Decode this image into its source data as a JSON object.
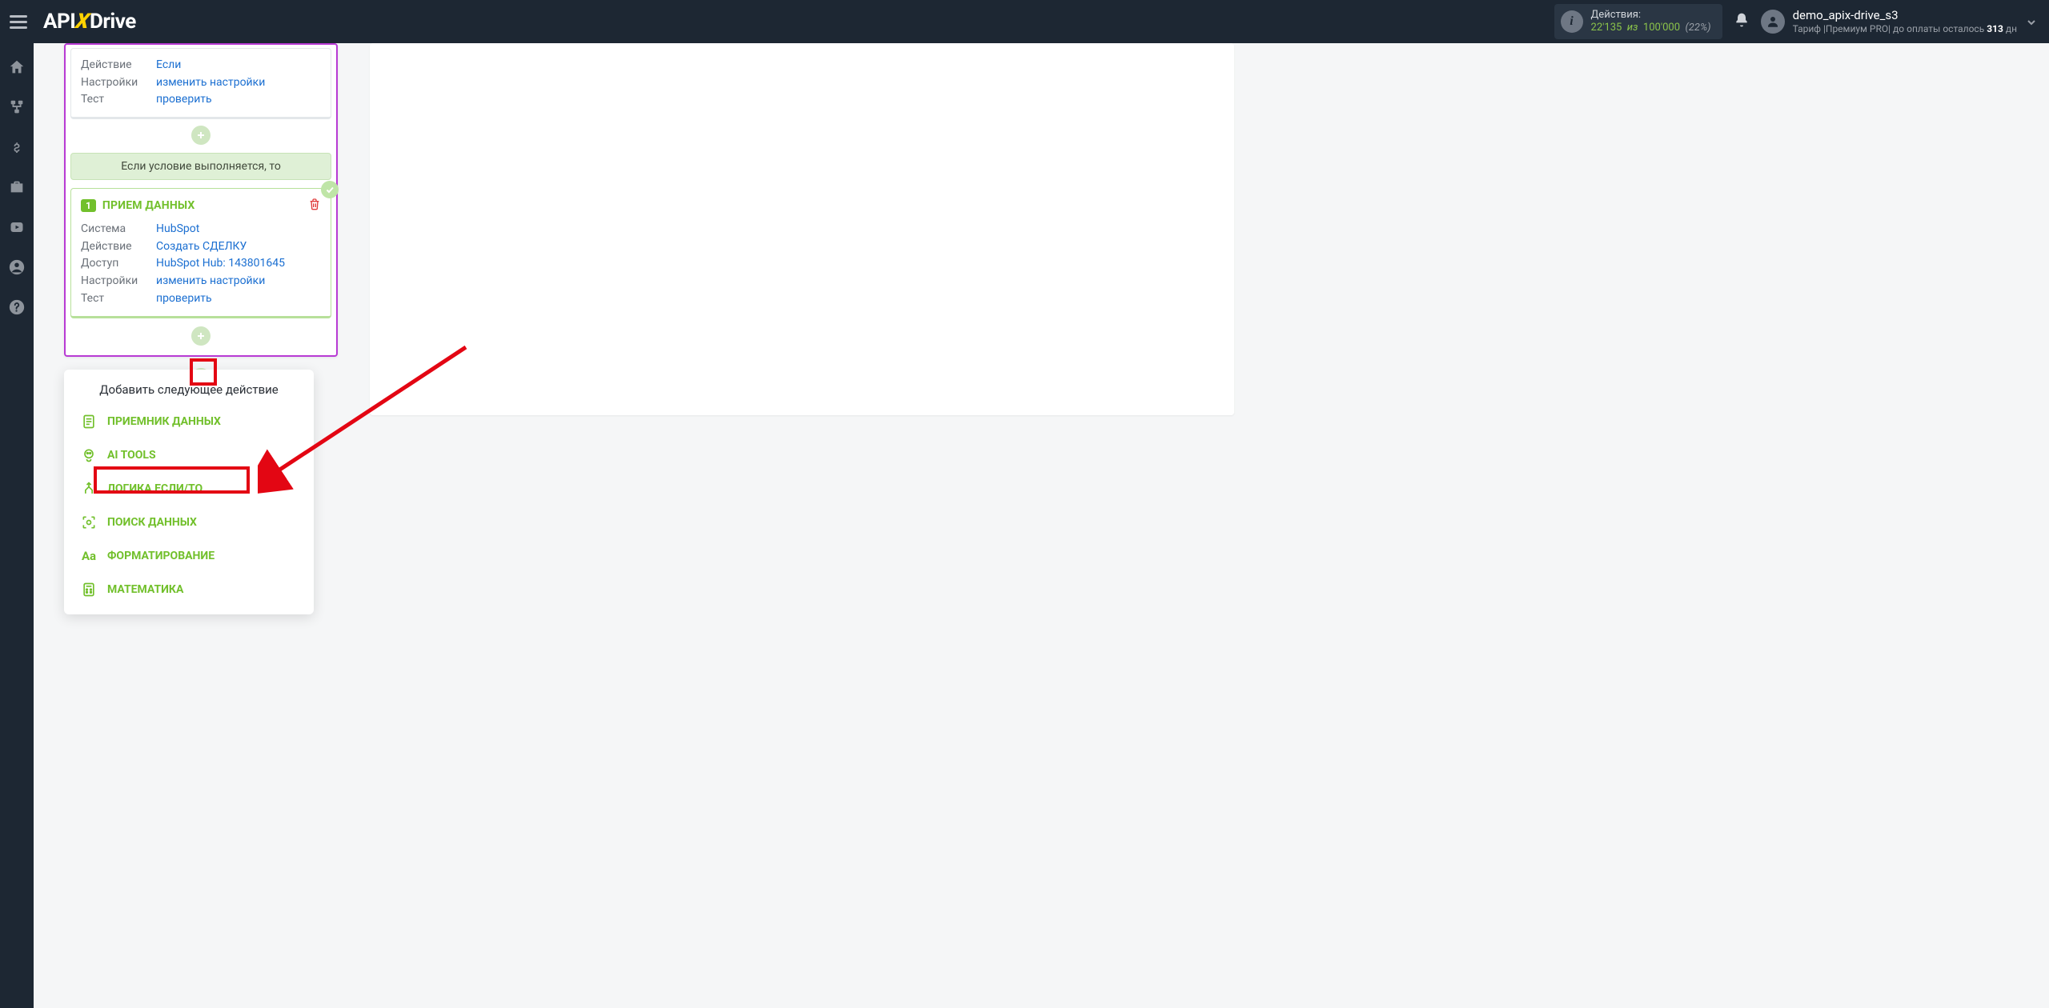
{
  "brand": {
    "pre": "API",
    "x": "X",
    "post": "Drive"
  },
  "header": {
    "actions_label": "Действия:",
    "actions_used": "22'135",
    "actions_of_word": "из",
    "actions_total": "100'000",
    "actions_pct": "(22%)",
    "user_name": "demo_apix-drive_s3",
    "tariff_pre": "Тариф |Премиум PRO| до оплаты осталось ",
    "tariff_days": "313",
    "tariff_post": " дн"
  },
  "card_condition": {
    "rows": [
      {
        "k": "Действие",
        "v": "Если"
      },
      {
        "k": "Настройки",
        "v": "изменить настройки"
      },
      {
        "k": "Тест",
        "v": "проверить"
      }
    ]
  },
  "cond_band": "Если условие выполняется, то",
  "card_green": {
    "num": "1",
    "title": "ПРИЕМ ДАННЫХ",
    "rows": [
      {
        "k": "Система",
        "v": "HubSpot"
      },
      {
        "k": "Действие",
        "v": "Создать СДЕЛКУ"
      },
      {
        "k": "Доступ",
        "v": "HubSpot Hub: 143801645"
      },
      {
        "k": "Настройки",
        "v": "изменить настройки"
      },
      {
        "k": "Тест",
        "v": "проверить"
      }
    ]
  },
  "popover": {
    "title": "Добавить следующее действие",
    "items": [
      {
        "icon": "file",
        "label": "ПРИЕМНИК ДАННЫХ"
      },
      {
        "icon": "ai",
        "label": "AI TOOLS"
      },
      {
        "icon": "branch",
        "label": "ЛОГИКА ЕСЛИ/ТО"
      },
      {
        "icon": "scan",
        "label": "ПОИСК ДАННЫХ"
      },
      {
        "icon": "aa",
        "label": "ФОРМАТИРОВАНИЕ"
      },
      {
        "icon": "calc",
        "label": "МАТЕМАТИКА"
      }
    ]
  }
}
